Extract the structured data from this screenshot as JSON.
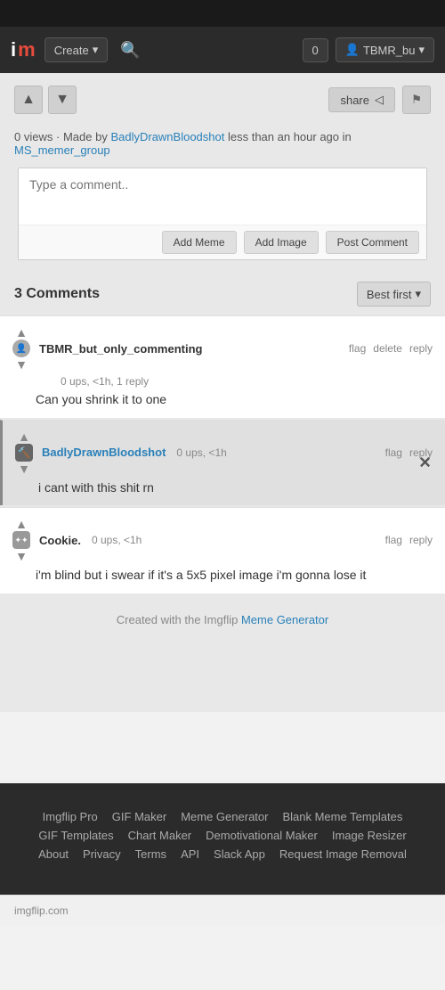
{
  "topbar": {},
  "navbar": {
    "logo_i": "i",
    "logo_m": "m",
    "create_label": "Create",
    "notif_count": "0",
    "user_label": "TBMR_bu",
    "chevron": "▾"
  },
  "vote_section": {
    "up_arrow": "▲",
    "down_arrow": "▼",
    "share_label": "share",
    "share_icon": "◁",
    "flag_icon": "⚑"
  },
  "views_row": {
    "views": "0 views",
    "dot": "·",
    "made_by": "Made by",
    "username": "BadlyDrawnBloodshot",
    "time": "less than an hour ago in",
    "group": "MS_memer_group"
  },
  "comment_box": {
    "placeholder": "Type a comment..",
    "add_meme_label": "Add Meme",
    "add_image_label": "Add Image",
    "post_comment_label": "Post Comment"
  },
  "comments_section": {
    "count_label": "3 Comments",
    "sort_label": "Best first",
    "sort_chevron": "▾"
  },
  "comments": [
    {
      "id": 1,
      "username": "TBMR_but_only_commenting",
      "username_color": "normal",
      "meta": "0 ups, <1h, 1 reply",
      "body": "Can you shrink it to one",
      "flag_label": "flag",
      "delete_label": "delete",
      "reply_label": "reply",
      "has_image": false
    },
    {
      "id": 2,
      "username": "BadlyDrawnBloodshot",
      "username_color": "blue",
      "meta": "0 ups, <1h",
      "body": "i cant with this shit rn",
      "flag_label": "flag",
      "reply_label": "reply",
      "has_image": true,
      "x_label": "×"
    },
    {
      "id": 3,
      "username": "Cookie.",
      "username_color": "normal",
      "meta": "0 ups, <1h",
      "body": "i'm blind but i swear if it's a 5x5 pixel image i'm gonna lose it",
      "flag_label": "flag",
      "reply_label": "reply",
      "has_image": false
    }
  ],
  "created_with": {
    "prefix": "Created with the Imgflip",
    "link_label": "Meme Generator"
  },
  "footer": {
    "links": [
      {
        "label": "Imgflip Pro"
      },
      {
        "label": "GIF Maker"
      },
      {
        "label": "Meme Generator"
      },
      {
        "label": "Blank Meme Templates"
      },
      {
        "label": "GIF Templates"
      },
      {
        "label": "Chart Maker"
      },
      {
        "label": "Demotivational Maker"
      },
      {
        "label": "Image Resizer"
      },
      {
        "label": "About"
      },
      {
        "label": "Privacy"
      },
      {
        "label": "Terms"
      },
      {
        "label": "API"
      },
      {
        "label": "Slack App"
      },
      {
        "label": "Request Image Removal"
      }
    ]
  },
  "bottom_bar": {
    "domain": "imgflip.com"
  }
}
